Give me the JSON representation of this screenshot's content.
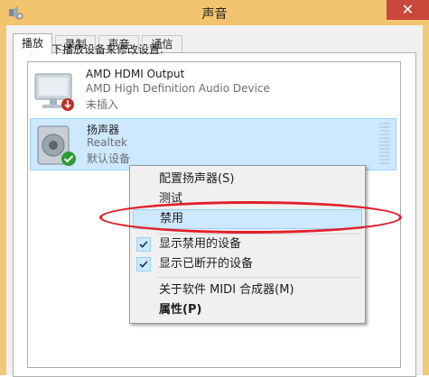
{
  "window": {
    "title": "声音",
    "close_glyph": "✕",
    "title_icon": "speaker-gear-icon"
  },
  "tabs": [
    {
      "label": "播放",
      "active": true
    },
    {
      "label": "录制",
      "active": false
    },
    {
      "label": "声音",
      "active": false
    },
    {
      "label": "通信",
      "active": false
    }
  ],
  "instruction": "选择以下播放设备来修改设置:",
  "devices": [
    {
      "name": "AMD HDMI Output",
      "line2": "AMD High Definition Audio Device",
      "line3": "未插入",
      "icon": "monitor-icon",
      "badge": "unplugged-badge-icon"
    },
    {
      "name": "扬声器",
      "line2": "Realtek",
      "line3": "默认设备",
      "icon": "speaker-icon",
      "badge": "default-check-badge-icon"
    }
  ],
  "context_menu": {
    "items": [
      {
        "label": "配置扬声器(S)"
      },
      {
        "label": "测试"
      },
      {
        "label": "禁用",
        "highlighted": true
      },
      {
        "label": "显示禁用的设备",
        "checked": true
      },
      {
        "label": "显示已断开的设备",
        "checked": true
      },
      {
        "label": "关于软件 MIDI 合成器(M)"
      },
      {
        "label": "属性(P)",
        "bold": true
      }
    ]
  },
  "colors": {
    "titlebar": "#f3c46f",
    "selection": "#cde8ff",
    "annotation": "#e0202a"
  }
}
